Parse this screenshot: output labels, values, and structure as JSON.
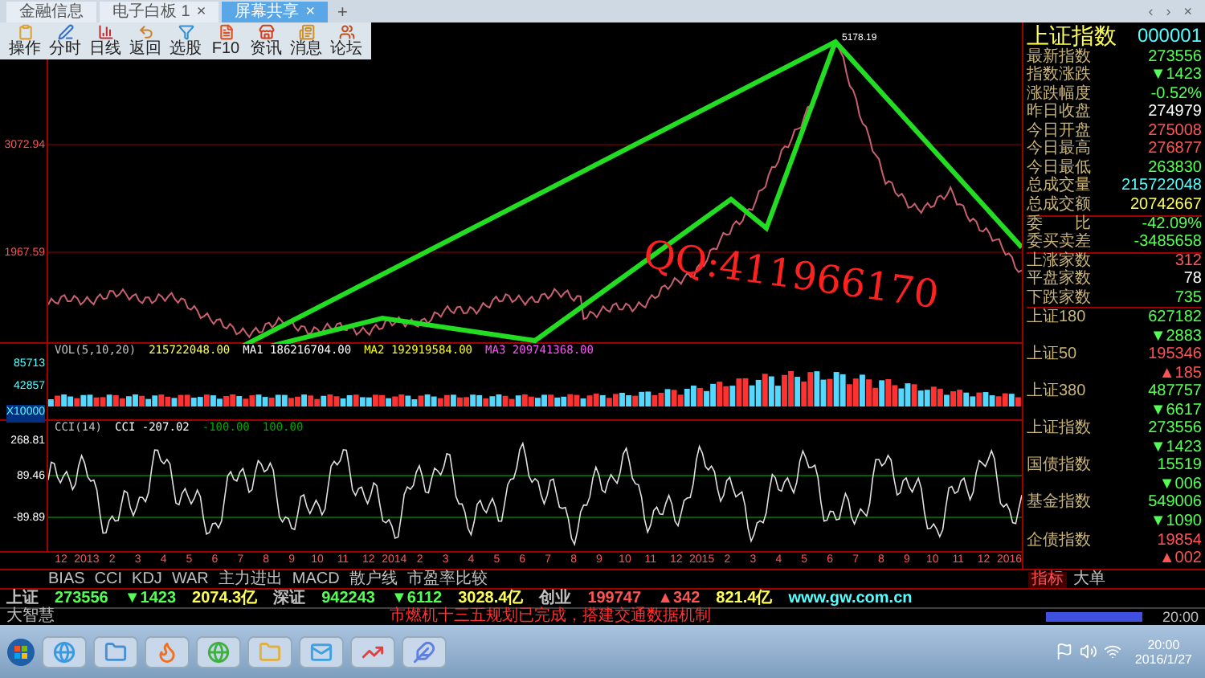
{
  "tabs": [
    {
      "label": "金融信息",
      "selected": false
    },
    {
      "label": "电子白板 1",
      "close": "×",
      "selected": false
    },
    {
      "label": "屏幕共享",
      "close": "×",
      "selected": true
    }
  ],
  "new_tab": "+",
  "window_controls": [
    "‹",
    "›",
    "×"
  ],
  "toolbar": [
    "操作",
    "分时",
    "日线",
    "返回",
    "选股",
    "F10",
    "资讯",
    "消息",
    "论坛"
  ],
  "price_chart": {
    "axis_labels": [
      "3072.94",
      "1967.59"
    ],
    "peak_label": "5178.19",
    "overlay_text": "QQ:411966170"
  },
  "volume_panel": {
    "legend": [
      {
        "text": "VOL(5,10,20)",
        "color": "#c0c0c0"
      },
      {
        "text": "215722048.00",
        "color": "#ffff54"
      },
      {
        "text": "MA1 186216704.00",
        "color": "#ffffff"
      },
      {
        "text": "MA2 192919584.00",
        "color": "#ffff00"
      },
      {
        "text": "MA3 209741368.00",
        "color": "#ff54ff"
      }
    ],
    "axis_labels": [
      "85713",
      "42857",
      "X10000"
    ]
  },
  "cci_panel": {
    "legend": [
      {
        "text": "CCI(14)",
        "color": "#c0c0c0"
      },
      {
        "text": "CCI -207.02",
        "color": "#ffffff"
      },
      {
        "text": "-100.00",
        "color": "#00a800"
      },
      {
        "text": "100.00",
        "color": "#00a800"
      }
    ],
    "axis_labels": [
      "268.81",
      "89.46",
      "-89.89"
    ]
  },
  "time_axis": [
    "12",
    "2013",
    "2",
    "3",
    "4",
    "5",
    "6",
    "7",
    "8",
    "9",
    "10",
    "11",
    "12",
    "2014",
    "2",
    "3",
    "4",
    "5",
    "6",
    "7",
    "8",
    "9",
    "10",
    "11",
    "12",
    "2015",
    "2",
    "3",
    "4",
    "5",
    "6",
    "7",
    "8",
    "9",
    "10",
    "11",
    "12",
    "2016"
  ],
  "indicator_tabs": [
    "BIAS",
    "CCI",
    "KDJ",
    "WAR",
    "主力进出",
    "MACD",
    "散户线",
    "市盈率比较"
  ],
  "panel_tabs": [
    {
      "label": "指标",
      "selected": true
    },
    {
      "label": "大单",
      "selected": false
    }
  ],
  "quote_panel": {
    "title": "上证指数",
    "code": "000001",
    "rows": [
      {
        "label": "最新指数",
        "value": "273556",
        "color": "#54ff54"
      },
      {
        "label": "指数涨跌",
        "value": "▼1423",
        "color": "#54ff54"
      },
      {
        "label": "涨跌幅度",
        "value": "-0.52%",
        "color": "#54ff54"
      },
      {
        "label": "昨日收盘",
        "value": "274979",
        "color": "#ffffff"
      },
      {
        "label": "今日开盘",
        "value": "275008",
        "color": "#ff5454"
      },
      {
        "label": "今日最高",
        "value": "276877",
        "color": "#ff5454"
      },
      {
        "label": "今日最低",
        "value": "263830",
        "color": "#54ff54"
      },
      {
        "label": "总成交量",
        "value": "215722048",
        "color": "#54ffff"
      },
      {
        "label": "总成交额",
        "value": "20742667",
        "color": "#ffff54"
      },
      {
        "label": "委　　比",
        "value": "-42.09%",
        "color": "#54ff54"
      },
      {
        "label": "委买卖差",
        "value": "-3485658",
        "color": "#54ff54"
      },
      {
        "label": "上涨家数",
        "value": "312",
        "color": "#ff5454"
      },
      {
        "label": "平盘家数",
        "value": "78",
        "color": "#ffffff"
      },
      {
        "label": "下跌家数",
        "value": "735",
        "color": "#54ff54"
      }
    ],
    "indices": [
      {
        "label": "上证180",
        "value": "627182",
        "change": "▼2883",
        "color": "#54ff54"
      },
      {
        "label": "上证50",
        "value": "195346",
        "change": "▲185",
        "color": "#ff5454"
      },
      {
        "label": "上证380",
        "value": "487757",
        "change": "▼6617",
        "color": "#54ff54"
      },
      {
        "label": "上证指数",
        "value": "273556",
        "change": "▼1423",
        "color": "#54ff54"
      },
      {
        "label": "国债指数",
        "value": "15519",
        "change": "▼006",
        "color": "#54ff54"
      },
      {
        "label": "基金指数",
        "value": "549006",
        "change": "▼1090",
        "color": "#54ff54"
      },
      {
        "label": "企债指数",
        "value": "19854",
        "change": "▲002",
        "color": "#ff5454"
      }
    ]
  },
  "status_bar": {
    "items": [
      {
        "text": "上证",
        "color": "#c0c0c0"
      },
      {
        "text": "273556",
        "color": "#54ff54"
      },
      {
        "text": "▼1423",
        "color": "#54ff54"
      },
      {
        "text": "2074.3亿",
        "color": "#ffff54"
      },
      {
        "text": "深证",
        "color": "#c0c0c0"
      },
      {
        "text": "942243",
        "color": "#54ff54"
      },
      {
        "text": "▼6112",
        "color": "#54ff54"
      },
      {
        "text": "3028.4亿",
        "color": "#ffff54"
      },
      {
        "text": "创业",
        "color": "#c0c0c0"
      },
      {
        "text": "199747",
        "color": "#ff5454"
      },
      {
        "text": "▲342",
        "color": "#ff5454"
      },
      {
        "text": "821.4亿",
        "color": "#ffff54"
      },
      {
        "text": "www.gw.com.cn",
        "color": "#54ffff"
      }
    ],
    "brand": "大智慧",
    "news": "市燃机十三五规划已完成，搭建交通数据机制",
    "time": "20:00"
  },
  "taskbar": {
    "time": "20:00",
    "date": "2016/1/27"
  }
}
